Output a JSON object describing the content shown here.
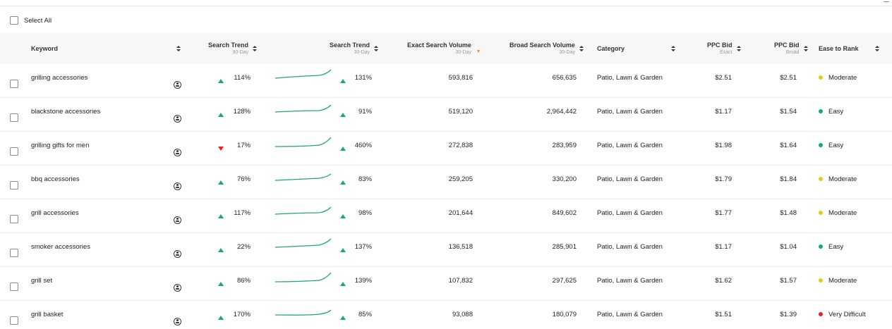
{
  "colors": {
    "trend_up": "#1aa872",
    "trend_down": "#e0251f",
    "sparkline": "#1aa872",
    "ease_moderate": "#f5c518",
    "ease_easy": "#1aa872",
    "ease_very_difficult": "#e0251f",
    "active_sort": "#f0892a"
  },
  "select_all_label": "Select All",
  "headers": {
    "keyword": "Keyword",
    "trend90": {
      "label": "Search Trend",
      "sub": "90-Day"
    },
    "trend30": {
      "label": "Search Trend",
      "sub": "30-Day"
    },
    "exact": {
      "label": "Exact Search Volume",
      "sub": "30-Day"
    },
    "broad": {
      "label": "Broad Search Volume",
      "sub": "30-Day"
    },
    "category": "Category",
    "ppc_exact": {
      "label": "PPC Bid",
      "sub": "Exact"
    },
    "ppc_broad": {
      "label": "PPC Bid",
      "sub": "Broad"
    },
    "ease": "Ease to Rank"
  },
  "rows": [
    {
      "keyword": "grilling accessories",
      "trend90_dir": "up",
      "trend90": "114%",
      "trend30_dir": "up",
      "trend30": "131%",
      "exact": "593,816",
      "broad": "656,635",
      "category": "Patio, Lawn & Garden",
      "ppc_exact": "$2.51",
      "ppc_broad": "$2.51",
      "ease": "Moderate",
      "ease_level": "moderate"
    },
    {
      "keyword": "blackstone accessories",
      "trend90_dir": "up",
      "trend90": "128%",
      "trend30_dir": "up",
      "trend30": "91%",
      "exact": "519,120",
      "broad": "2,964,442",
      "category": "Patio, Lawn & Garden",
      "ppc_exact": "$1.17",
      "ppc_broad": "$1.54",
      "ease": "Easy",
      "ease_level": "easy"
    },
    {
      "keyword": "grilling gifts for men",
      "trend90_dir": "down",
      "trend90": "17%",
      "trend30_dir": "up",
      "trend30": "460%",
      "exact": "272,838",
      "broad": "283,959",
      "category": "Patio, Lawn & Garden",
      "ppc_exact": "$1.98",
      "ppc_broad": "$1.64",
      "ease": "Easy",
      "ease_level": "easy"
    },
    {
      "keyword": "bbq accessories",
      "trend90_dir": "up",
      "trend90": "76%",
      "trend30_dir": "up",
      "trend30": "83%",
      "exact": "259,205",
      "broad": "330,200",
      "category": "Patio, Lawn & Garden",
      "ppc_exact": "$1.79",
      "ppc_broad": "$1.84",
      "ease": "Moderate",
      "ease_level": "moderate"
    },
    {
      "keyword": "grill accessories",
      "trend90_dir": "up",
      "trend90": "117%",
      "trend30_dir": "up",
      "trend30": "98%",
      "exact": "201,644",
      "broad": "849,602",
      "category": "Patio, Lawn & Garden",
      "ppc_exact": "$1.77",
      "ppc_broad": "$1.48",
      "ease": "Moderate",
      "ease_level": "moderate"
    },
    {
      "keyword": "smoker accessories",
      "trend90_dir": "up",
      "trend90": "22%",
      "trend30_dir": "up",
      "trend30": "137%",
      "exact": "136,518",
      "broad": "285,901",
      "category": "Patio, Lawn & Garden",
      "ppc_exact": "$1.17",
      "ppc_broad": "$1.04",
      "ease": "Easy",
      "ease_level": "easy"
    },
    {
      "keyword": "grill set",
      "trend90_dir": "up",
      "trend90": "86%",
      "trend30_dir": "up",
      "trend30": "139%",
      "exact": "107,832",
      "broad": "297,625",
      "category": "Patio, Lawn & Garden",
      "ppc_exact": "$1.62",
      "ppc_broad": "$1.57",
      "ease": "Moderate",
      "ease_level": "moderate"
    },
    {
      "keyword": "grill basket",
      "trend90_dir": "up",
      "trend90": "170%",
      "trend30_dir": "up",
      "trend30": "85%",
      "exact": "93,088",
      "broad": "180,079",
      "category": "Patio, Lawn & Garden",
      "ppc_exact": "$1.51",
      "ppc_broad": "$1.39",
      "ease": "Very Difficult",
      "ease_level": "very_difficult"
    }
  ]
}
